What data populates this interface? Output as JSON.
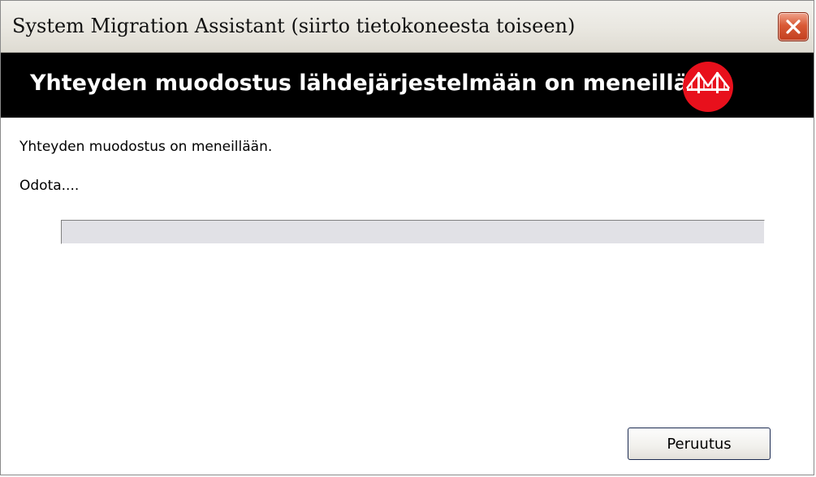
{
  "window": {
    "title": "System Migration Assistant (siirto tietokoneesta toiseen)",
    "close_icon": "close-x-icon"
  },
  "banner": {
    "heading": "Yhteyden muodostus lähdejärjestelmään on meneillään",
    "logo_icon": "bridge-logo-icon",
    "background_color": "#000000",
    "logo_color": "#e8101c"
  },
  "content": {
    "status_message": "Yhteyden muodostus on meneillään.",
    "wait_message": "Odota....",
    "progress": 0
  },
  "buttons": {
    "cancel_label": "Peruutus"
  }
}
